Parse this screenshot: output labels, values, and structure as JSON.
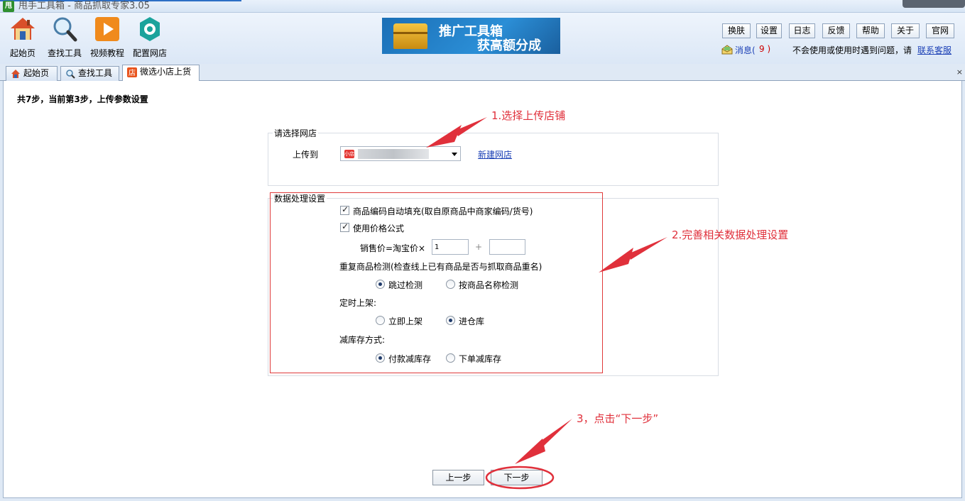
{
  "window": {
    "app_icon_text": "甩",
    "title": "甩手工具箱 - 商品抓取专家3.05"
  },
  "toolbar": {
    "tools": [
      {
        "label": "起始页",
        "icon": "home-icon"
      },
      {
        "label": "查找工具",
        "icon": "magnifier-icon"
      },
      {
        "label": "视频教程",
        "icon": "play-icon"
      },
      {
        "label": "配置网店",
        "icon": "gear-icon"
      }
    ],
    "banner": {
      "line1": "推广工具箱",
      "line2": "获高额分成"
    },
    "buttons": [
      "换肤",
      "设置",
      "日志",
      "反馈",
      "帮助",
      "关于",
      "官网"
    ],
    "message_label": "消息(",
    "message_count": "9 )",
    "hint_text": "不会使用或使用时遇到问题，请",
    "support_link": "联系客服"
  },
  "tabs": [
    {
      "label": "起始页",
      "icon": "home-icon"
    },
    {
      "label": "查找工具",
      "icon": "magnifier-icon"
    },
    {
      "label": "微选小店上货",
      "icon": "shop-icon",
      "active": true
    }
  ],
  "tab_close": "×",
  "main": {
    "step_title": "共7步，当前第3步，上传参数设置",
    "shop_group": {
      "legend": "请选择网店",
      "upload_label": "上传到",
      "shop_icon_text": "小店",
      "new_shop_link": "新建网店"
    },
    "data_group": {
      "legend": "数据处理设置",
      "auto_fill_label": "商品编码自动填充(取自原商品中商家编码/货号)",
      "auto_fill_checked": true,
      "price_formula_label": "使用价格公式",
      "price_formula_checked": true,
      "price_label": "销售价=淘宝价×",
      "price_multiplier": "1",
      "plus_sign": "+",
      "price_addend": "",
      "duplicate_label": "重复商品检测(检查线上已有商品是否与抓取商品重名)",
      "duplicate_options": [
        "跳过检测",
        "按商品名称检测"
      ],
      "duplicate_selected": "跳过检测",
      "schedule_label": "定时上架:",
      "schedule_options": [
        "立即上架",
        "进仓库"
      ],
      "schedule_selected": "进仓库",
      "stock_label": "减库存方式:",
      "stock_options": [
        "付款减库存",
        "下单减库存"
      ],
      "stock_selected": "付款减库存"
    },
    "prev_button": "上一步",
    "next_button": "下一步"
  },
  "annotations": {
    "step1": "1.选择上传店铺",
    "step2": "2.完善相关数据处理设置",
    "step3": "3，点击“下一步”",
    "color": "#e0303b"
  }
}
